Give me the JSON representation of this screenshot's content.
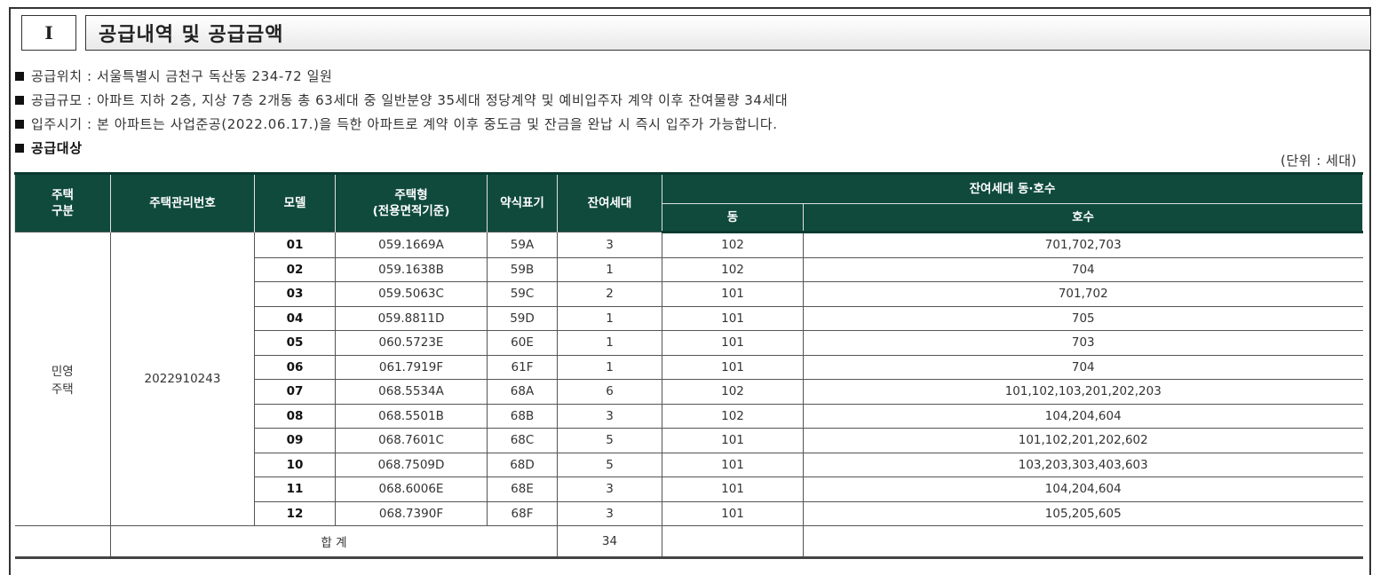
{
  "section": {
    "number": "I",
    "title": "공급내역 및 공급금액"
  },
  "bullets": [
    "공급위치 : 서울특별시 금천구 독산동 234-72 일원",
    "공급규모 : 아파트 지하 2층, 지상 7층 2개동 총 63세대 중 일반분양 35세대 정당계약 및 예비입주자 계약 이후 잔여물량 34세대",
    "입주시기 : 본 아파트는 사업준공(2022.06.17.)을 득한 아파트로 계약 이후 중도금 및 잔금을 완납 시 즉시 입주가 가능합니다."
  ],
  "subheading": "공급대상",
  "unit": "(단위 : 세대)",
  "table": {
    "headers": {
      "housing_type_l1": "주택",
      "housing_type_l2": "구분",
      "mgmt_no": "주택관리번호",
      "model": "모델",
      "house_type_l1": "주택형",
      "house_type_l2": "(전용면적기준)",
      "abbr": "약식표기",
      "remaining": "잔여세대",
      "remaining_units": "잔여세대 동·호수",
      "dong": "동",
      "ho": "호수"
    },
    "housing_type_l1": "민영",
    "housing_type_l2": "주택",
    "mgmt_no": "2022910243",
    "rows": [
      {
        "model": "01",
        "type": "059.1669A",
        "abbr": "59A",
        "remaining": "3",
        "dong": "102",
        "ho": "701,702,703"
      },
      {
        "model": "02",
        "type": "059.1638B",
        "abbr": "59B",
        "remaining": "1",
        "dong": "102",
        "ho": "704"
      },
      {
        "model": "03",
        "type": "059.5063C",
        "abbr": "59C",
        "remaining": "2",
        "dong": "101",
        "ho": "701,702"
      },
      {
        "model": "04",
        "type": "059.8811D",
        "abbr": "59D",
        "remaining": "1",
        "dong": "101",
        "ho": "705"
      },
      {
        "model": "05",
        "type": "060.5723E",
        "abbr": "60E",
        "remaining": "1",
        "dong": "101",
        "ho": "703"
      },
      {
        "model": "06",
        "type": "061.7919F",
        "abbr": "61F",
        "remaining": "1",
        "dong": "101",
        "ho": "704"
      },
      {
        "model": "07",
        "type": "068.5534A",
        "abbr": "68A",
        "remaining": "6",
        "dong": "102",
        "ho": "101,102,103,201,202,203"
      },
      {
        "model": "08",
        "type": "068.5501B",
        "abbr": "68B",
        "remaining": "3",
        "dong": "102",
        "ho": "104,204,604"
      },
      {
        "model": "09",
        "type": "068.7601C",
        "abbr": "68C",
        "remaining": "5",
        "dong": "101",
        "ho": "101,102,201,202,602"
      },
      {
        "model": "10",
        "type": "068.7509D",
        "abbr": "68D",
        "remaining": "5",
        "dong": "101",
        "ho": "103,203,303,403,603"
      },
      {
        "model": "11",
        "type": "068.6006E",
        "abbr": "68E",
        "remaining": "3",
        "dong": "101",
        "ho": "104,204,604"
      },
      {
        "model": "12",
        "type": "068.7390F",
        "abbr": "68F",
        "remaining": "3",
        "dong": "101",
        "ho": "105,205,605"
      }
    ],
    "total_label": "합  계",
    "total_value": "34"
  }
}
